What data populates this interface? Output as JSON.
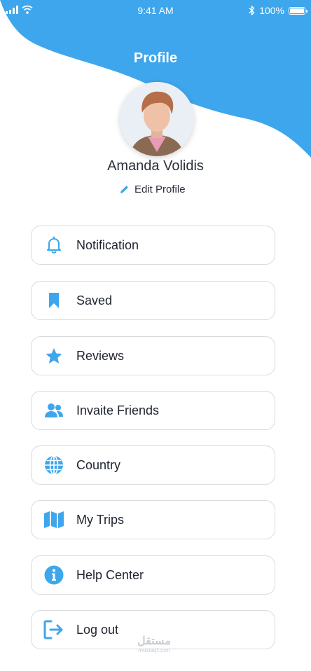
{
  "status_bar": {
    "time": "9:41 AM",
    "battery": "100%"
  },
  "header": {
    "title": "Profile"
  },
  "profile": {
    "name": "Amanda Volidis",
    "edit_label": "Edit Profile"
  },
  "menu": [
    {
      "label": "Notification",
      "icon": "bell-icon"
    },
    {
      "label": "Saved",
      "icon": "bookmark-icon"
    },
    {
      "label": "Reviews",
      "icon": "star-icon"
    },
    {
      "label": "Invaite Friends",
      "icon": "users-icon"
    },
    {
      "label": "Country",
      "icon": "globe-icon"
    },
    {
      "label": "My Trips",
      "icon": "map-icon"
    },
    {
      "label": "Help Center",
      "icon": "info-icon"
    },
    {
      "label": "Log out",
      "icon": "logout-icon"
    }
  ],
  "watermark": {
    "text": "مستقل",
    "sub": "mostaql.com"
  },
  "colors": {
    "accent": "#3ea6ec",
    "text": "#1f2430",
    "border": "#d7dbe0"
  }
}
